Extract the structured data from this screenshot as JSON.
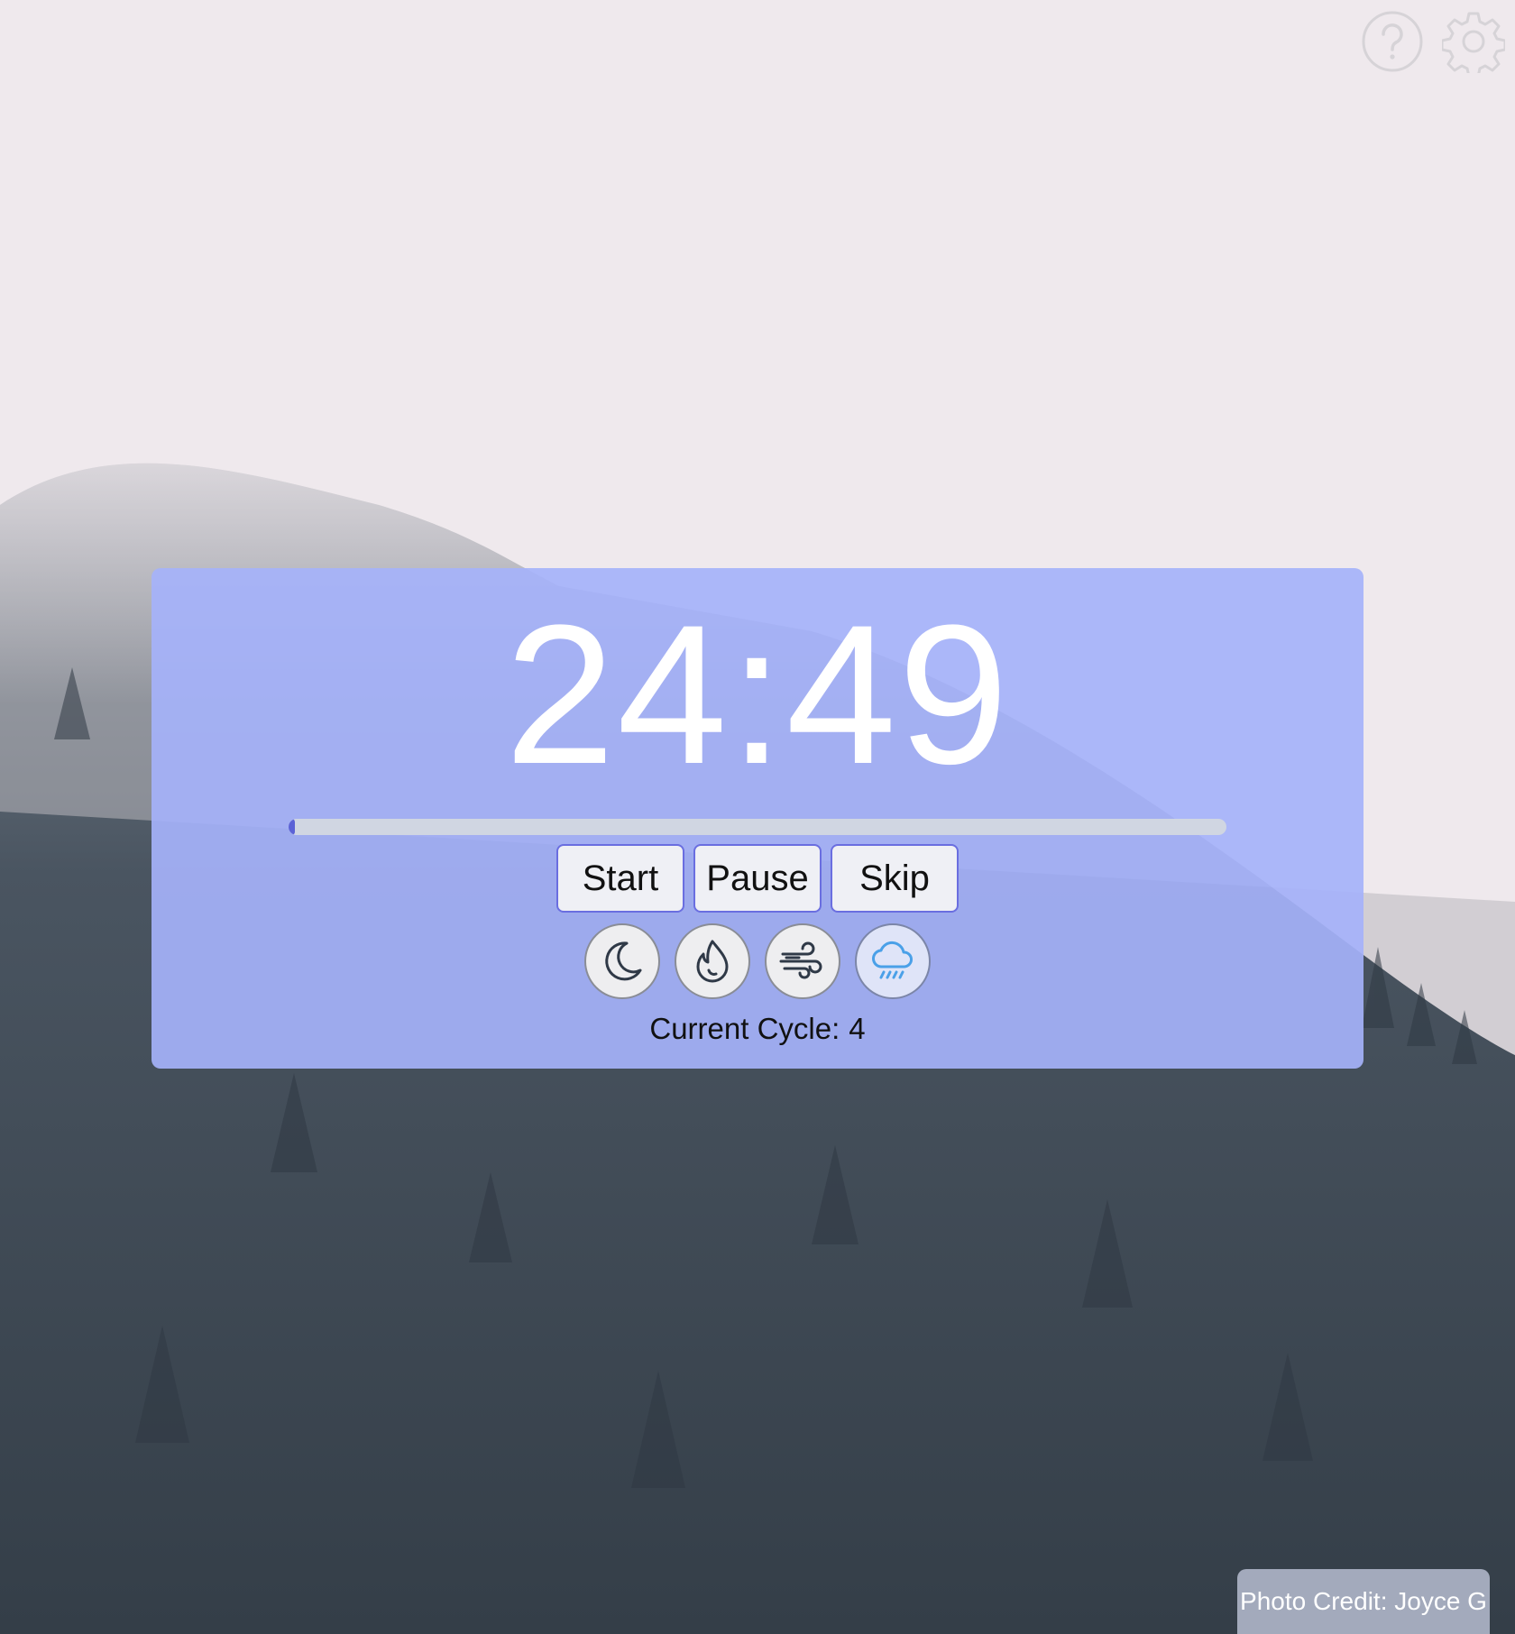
{
  "timer": {
    "display": "24:49",
    "progress_fraction": 0.007
  },
  "controls": {
    "start_label": "Start",
    "pause_label": "Pause",
    "skip_label": "Skip"
  },
  "sounds": [
    {
      "icon": "moon-icon",
      "active": false
    },
    {
      "icon": "flame-icon",
      "active": false
    },
    {
      "icon": "wind-icon",
      "active": false
    },
    {
      "icon": "rain-cloud-icon",
      "active": true
    }
  ],
  "cycle": {
    "label": "Current Cycle:",
    "value": "4"
  },
  "top_icons": [
    "help-icon",
    "settings-icon"
  ],
  "photo_credit": "Photo Credit: Joyce G",
  "colors": {
    "panel": "#a5b2fa",
    "progress_fill": "#5b62d6",
    "button_border": "#6a6ee0",
    "active_sound_icon": "#4aa0e8"
  }
}
